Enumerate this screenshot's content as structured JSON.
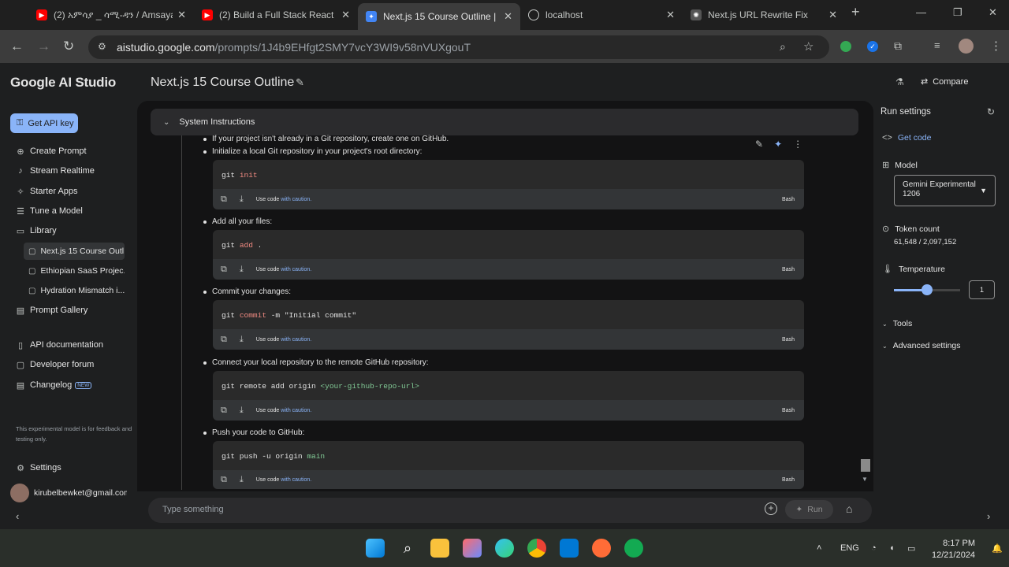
{
  "browser": {
    "tabs": [
      {
        "title": "(2) አምሳያ _ ሳሚ-ዳን / Amsaya",
        "icon": "youtube-icon"
      },
      {
        "title": "(2) Build a Full Stack React N",
        "icon": "youtube-icon"
      },
      {
        "title": "Next.js 15 Course Outline | G",
        "icon": "ai-studio-icon",
        "active": true
      },
      {
        "title": "localhost",
        "icon": "globe-icon"
      },
      {
        "title": "Next.js URL Rewrite Fix",
        "icon": "chatgpt-icon"
      }
    ],
    "url_host": "aistudio.google.com",
    "url_path": "/prompts/1J4b9EHfgt2SMY7vcY3WI9v58nVUXgouT"
  },
  "sidebar": {
    "brand": "Google AI Studio",
    "api_key": "Get API key",
    "nav": [
      {
        "label": "Create Prompt",
        "icon": "create-prompt-icon"
      },
      {
        "label": "Stream Realtime",
        "icon": "mic-icon"
      },
      {
        "label": "Starter Apps",
        "icon": "sparkle-icon"
      },
      {
        "label": "Tune a Model",
        "icon": "tune-icon"
      },
      {
        "label": "Library",
        "icon": "library-icon"
      }
    ],
    "library_items": [
      "Next.js 15 Course Outl...",
      "Ethiopian SaaS Projec...",
      "Hydration Mismatch i..."
    ],
    "prompt_gallery": "Prompt Gallery",
    "api_docs": "API documentation",
    "forum": "Developer forum",
    "changelog": "Changelog",
    "new_badge": "NEW",
    "note": "This experimental model is for feedback and testing only.",
    "settings": "Settings",
    "account": "kirubelbewket@gmail.com"
  },
  "header": {
    "title": "Next.js 15 Course Outline",
    "compare": "Compare"
  },
  "main": {
    "system_instructions": "System Instructions",
    "bullets": [
      "If your project isn't already in a Git repository, create one on GitHub.",
      "Initialize a local Git repository in your project's root directory:",
      "Add all your files:",
      "Commit your changes:",
      "Connect your local repository to the remote GitHub repository:",
      "Push your code to GitHub:"
    ],
    "code_blocks": [
      {
        "cmd": "git",
        "kw": "init",
        "rest": ""
      },
      {
        "cmd": "git",
        "kw": "add",
        "rest": " ."
      },
      {
        "cmd": "git",
        "kw": "commit",
        "rest": " -m \"Initial commit\""
      },
      {
        "cmd": "git remote add origin",
        "kw": "",
        "rest": " <your-github-repo-url>"
      },
      {
        "cmd": "git push -u origin",
        "kw": "",
        "rest": " main"
      }
    ],
    "use_code": "Use code",
    "with_caution": "with caution.",
    "lang": "Bash",
    "input_placeholder": "Type something",
    "run": "Run"
  },
  "run_settings": {
    "title": "Run settings",
    "get_code": "Get code",
    "model_label": "Model",
    "model_value": "Gemini Experimental 1206",
    "token_label": "Token count",
    "token_value": "61,548 / 2,097,152",
    "temperature_label": "Temperature",
    "temperature_value": "1",
    "temperature_fraction": 0.5,
    "tools": "Tools",
    "advanced": "Advanced settings"
  },
  "taskbar": {
    "lang": "ENG",
    "time": "8:17 PM",
    "date": "12/21/2024"
  },
  "colors": {
    "accent": "#8ab4f8",
    "keyword": "#f28b82",
    "string_green": "#81c995"
  }
}
